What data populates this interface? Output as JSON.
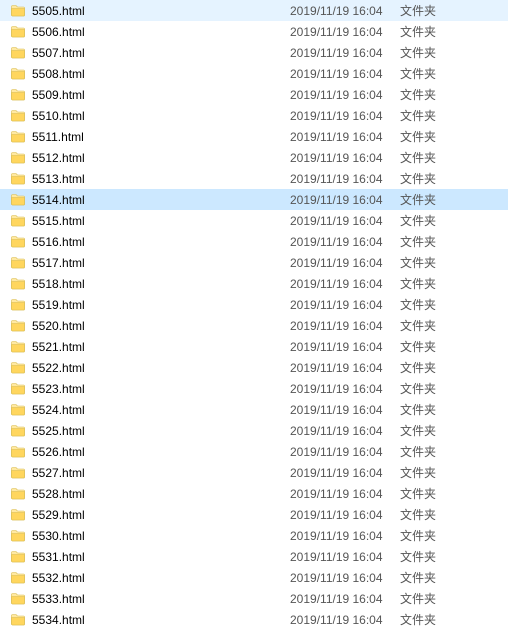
{
  "selectedIndex": 9,
  "files": [
    {
      "name": "5505.html",
      "date": "2019/11/19 16:04",
      "type": "文件夹"
    },
    {
      "name": "5506.html",
      "date": "2019/11/19 16:04",
      "type": "文件夹"
    },
    {
      "name": "5507.html",
      "date": "2019/11/19 16:04",
      "type": "文件夹"
    },
    {
      "name": "5508.html",
      "date": "2019/11/19 16:04",
      "type": "文件夹"
    },
    {
      "name": "5509.html",
      "date": "2019/11/19 16:04",
      "type": "文件夹"
    },
    {
      "name": "5510.html",
      "date": "2019/11/19 16:04",
      "type": "文件夹"
    },
    {
      "name": "5511.html",
      "date": "2019/11/19 16:04",
      "type": "文件夹"
    },
    {
      "name": "5512.html",
      "date": "2019/11/19 16:04",
      "type": "文件夹"
    },
    {
      "name": "5513.html",
      "date": "2019/11/19 16:04",
      "type": "文件夹"
    },
    {
      "name": "5514.html",
      "date": "2019/11/19 16:04",
      "type": "文件夹"
    },
    {
      "name": "5515.html",
      "date": "2019/11/19 16:04",
      "type": "文件夹"
    },
    {
      "name": "5516.html",
      "date": "2019/11/19 16:04",
      "type": "文件夹"
    },
    {
      "name": "5517.html",
      "date": "2019/11/19 16:04",
      "type": "文件夹"
    },
    {
      "name": "5518.html",
      "date": "2019/11/19 16:04",
      "type": "文件夹"
    },
    {
      "name": "5519.html",
      "date": "2019/11/19 16:04",
      "type": "文件夹"
    },
    {
      "name": "5520.html",
      "date": "2019/11/19 16:04",
      "type": "文件夹"
    },
    {
      "name": "5521.html",
      "date": "2019/11/19 16:04",
      "type": "文件夹"
    },
    {
      "name": "5522.html",
      "date": "2019/11/19 16:04",
      "type": "文件夹"
    },
    {
      "name": "5523.html",
      "date": "2019/11/19 16:04",
      "type": "文件夹"
    },
    {
      "name": "5524.html",
      "date": "2019/11/19 16:04",
      "type": "文件夹"
    },
    {
      "name": "5525.html",
      "date": "2019/11/19 16:04",
      "type": "文件夹"
    },
    {
      "name": "5526.html",
      "date": "2019/11/19 16:04",
      "type": "文件夹"
    },
    {
      "name": "5527.html",
      "date": "2019/11/19 16:04",
      "type": "文件夹"
    },
    {
      "name": "5528.html",
      "date": "2019/11/19 16:04",
      "type": "文件夹"
    },
    {
      "name": "5529.html",
      "date": "2019/11/19 16:04",
      "type": "文件夹"
    },
    {
      "name": "5530.html",
      "date": "2019/11/19 16:04",
      "type": "文件夹"
    },
    {
      "name": "5531.html",
      "date": "2019/11/19 16:04",
      "type": "文件夹"
    },
    {
      "name": "5532.html",
      "date": "2019/11/19 16:04",
      "type": "文件夹"
    },
    {
      "name": "5533.html",
      "date": "2019/11/19 16:04",
      "type": "文件夹"
    },
    {
      "name": "5534.html",
      "date": "2019/11/19 16:04",
      "type": "文件夹"
    }
  ]
}
